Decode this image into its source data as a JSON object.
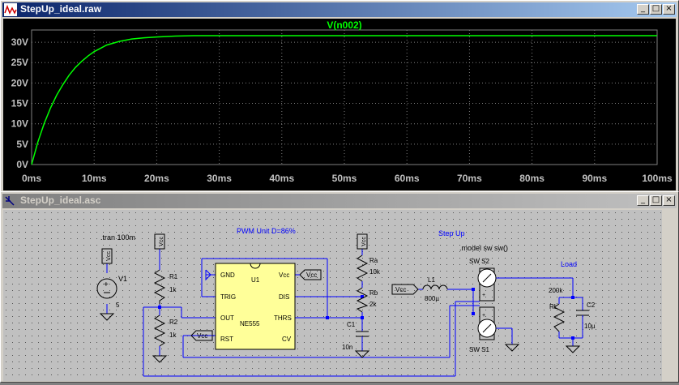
{
  "waveform_window": {
    "title": "StepUp_ideal.raw",
    "buttons": {
      "minimize": "_",
      "maximize": "□",
      "close": "×"
    }
  },
  "schematic_window": {
    "title": "StepUp_ideal.asc",
    "buttons": {
      "minimize": "_",
      "maximize": "□",
      "close": "×"
    }
  },
  "chart_data": {
    "type": "line",
    "title": "V(n002)",
    "xlabel": "",
    "ylabel": "",
    "x_ticks": [
      "0ms",
      "10ms",
      "20ms",
      "30ms",
      "40ms",
      "50ms",
      "60ms",
      "70ms",
      "80ms",
      "90ms",
      "100ms"
    ],
    "y_ticks": [
      "0V",
      "5V",
      "10V",
      "15V",
      "20V",
      "25V",
      "30V"
    ],
    "xlim": [
      0,
      100
    ],
    "ylim": [
      0,
      33
    ],
    "grid": true,
    "series": [
      {
        "name": "V(n002)",
        "color": "#00ff00",
        "x": [
          0,
          1,
          2,
          3,
          4,
          5,
          6,
          7,
          8,
          9,
          10,
          12,
          14,
          16,
          18,
          20,
          23,
          26,
          30,
          40,
          50,
          60,
          70,
          80,
          90,
          100
        ],
        "y": [
          0,
          5.5,
          10,
          13.8,
          17,
          19.6,
          21.9,
          23.8,
          25.3,
          26.6,
          27.7,
          29.3,
          30.2,
          30.8,
          31.1,
          31.3,
          31.5,
          31.6,
          31.6,
          31.6,
          31.6,
          31.6,
          31.6,
          31.6,
          31.6,
          31.6
        ]
      }
    ]
  },
  "schematic": {
    "directives": {
      "tran": ".tran 100m",
      "model": ".model sw sw()"
    },
    "section_labels": {
      "pwm": "PWM Unit  D=86%",
      "stepup": "Step Up",
      "load": "Load"
    },
    "components": {
      "V1": {
        "name": "V1",
        "value": "5"
      },
      "R1": {
        "name": "R1",
        "value": "1k"
      },
      "R2": {
        "name": "R2",
        "value": "1k"
      },
      "U1": {
        "name": "U1",
        "part": "NE555",
        "pins": {
          "gnd": "GND",
          "vcc": "Vcc",
          "trig": "TRIG",
          "dis": "DIS",
          "out": "OUT",
          "thrs": "THRS",
          "rst": "RST",
          "cv": "CV"
        }
      },
      "Ra": {
        "name": "Ra",
        "value": "10k"
      },
      "Rb": {
        "name": "Rb",
        "value": "2k"
      },
      "C1": {
        "name": "C1",
        "value": "10n"
      },
      "L1": {
        "name": "L1",
        "value": "800µ"
      },
      "S2": {
        "name": "SW   S2"
      },
      "S1": {
        "name": "SW   S1"
      },
      "RL": {
        "name": "RL",
        "value": "200k"
      },
      "C2": {
        "name": "C2",
        "value": "10µ"
      }
    },
    "net_labels": {
      "vcc": "Vcc"
    }
  }
}
